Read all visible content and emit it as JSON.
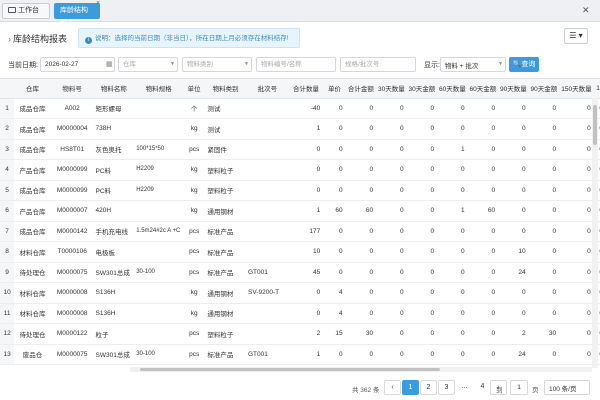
{
  "tabs": {
    "workbench": "工作台",
    "active": "库龄结构报表"
  },
  "page": {
    "title": "库龄结构报表",
    "notice": "说明：选择的当前日期（非当日），所在日期上月必须存在材料结存!"
  },
  "filters": {
    "date_label": "当前日期:",
    "date_value": "2026-02-27",
    "warehouse_placeholder": "仓库",
    "category_placeholder": "物料类别",
    "material_placeholder": "物料编号/名称",
    "spec_placeholder": "规格/批次号",
    "display_label": "显示:",
    "display_value": "物料 + 批次",
    "search_label": "查询"
  },
  "table": {
    "headers": [
      "",
      "仓库",
      "物料号",
      "物料名称",
      "物料规格",
      "单位",
      "物料类别",
      "批次号",
      "合计数量",
      "单价",
      "合计金额",
      "30天数量",
      "30天金额",
      "60天数量",
      "60天金额",
      "90天数量",
      "90天金额",
      "150天数量",
      "15"
    ],
    "rows": [
      [
        "1",
        "成品仓库",
        "A002",
        "矩形螺母",
        "",
        "个",
        "测试",
        "",
        "-40",
        "0",
        "0",
        "0",
        "0",
        "0",
        "0",
        "0",
        "0",
        "0",
        "0"
      ],
      [
        "2",
        "成品仓库",
        "M0000004",
        "738H",
        "",
        "kg",
        "测试",
        "",
        "1",
        "0",
        "0",
        "0",
        "0",
        "0",
        "0",
        "0",
        "0",
        "0",
        "0"
      ],
      [
        "3",
        "成品仓库",
        "HS8T01",
        "灰色奥托",
        "100*15*50",
        "pcs",
        "紧固件",
        "",
        "0",
        "0",
        "0",
        "0",
        "0",
        "1",
        "0",
        "0",
        "0",
        "0",
        "0"
      ],
      [
        "4",
        "产品仓库",
        "M0000099",
        "PC料",
        "H2209",
        "kg",
        "塑料粒子",
        "",
        "0",
        "0",
        "0",
        "0",
        "0",
        "0",
        "0",
        "0",
        "0",
        "0",
        "0"
      ],
      [
        "5",
        "成品仓库",
        "M0000099",
        "PC料",
        "H2209",
        "kg",
        "塑料粒子",
        "",
        "0",
        "0",
        "0",
        "0",
        "0",
        "0",
        "0",
        "0",
        "0",
        "0",
        "0"
      ],
      [
        "6",
        "产品仓库",
        "M0000007",
        "420H",
        "",
        "kg",
        "通用钢材",
        "",
        "1",
        "60",
        "60",
        "0",
        "0",
        "1",
        "60",
        "0",
        "0",
        "0",
        "0"
      ],
      [
        "7",
        "成品仓库",
        "M0000142",
        "手机充电线",
        "1.5m24#2c A +C",
        "pcs",
        "标准产品",
        "",
        "177",
        "0",
        "0",
        "0",
        "0",
        "0",
        "0",
        "0",
        "0",
        "0",
        "0"
      ],
      [
        "8",
        "材料仓库",
        "T0000106",
        "电极板",
        "",
        "pcs",
        "标准产品",
        "",
        "10",
        "0",
        "0",
        "0",
        "0",
        "0",
        "0",
        "10",
        "0",
        "0",
        "0"
      ],
      [
        "9",
        "待处理仓",
        "M0000075",
        "SW301总成",
        "30-100",
        "pcs",
        "标准产品",
        "GT001",
        "45",
        "0",
        "0",
        "0",
        "0",
        "0",
        "0",
        "24",
        "0",
        "0",
        "0"
      ],
      [
        "10",
        "材料仓库",
        "M0000008",
        "S136H",
        "",
        "kg",
        "通用钢材",
        "SV-9200-T",
        "0",
        "4",
        "0",
        "0",
        "0",
        "0",
        "0",
        "0",
        "0",
        "0",
        "0"
      ],
      [
        "11",
        "材料仓库",
        "M0000008",
        "S136H",
        "",
        "kg",
        "通用钢材",
        "",
        "0",
        "4",
        "0",
        "0",
        "0",
        "0",
        "0",
        "0",
        "0",
        "0",
        "0"
      ],
      [
        "12",
        "待处理仓",
        "M0000122",
        "粒子",
        "",
        "pcs",
        "塑料粒子",
        "",
        "2",
        "15",
        "30",
        "0",
        "0",
        "0",
        "0",
        "2",
        "30",
        "0",
        "0"
      ],
      [
        "13",
        "废品仓",
        "M0000075",
        "SW301总成",
        "30-100",
        "pcs",
        "标准产品",
        "GT001",
        "1",
        "0",
        "0",
        "0",
        "0",
        "0",
        "0",
        "24",
        "0",
        "0",
        "0"
      ]
    ]
  },
  "pagination": {
    "total": "共 362 条",
    "pages": [
      "1",
      "2",
      "3"
    ],
    "ellipsis": "...",
    "last_page": "4",
    "goto_label": "到",
    "goto_value": "1",
    "page_suffix": "页",
    "page_size": "100 条/页"
  },
  "colors": {
    "accent": "#3d9bd9",
    "notice_bg": "#e8f4fb"
  }
}
